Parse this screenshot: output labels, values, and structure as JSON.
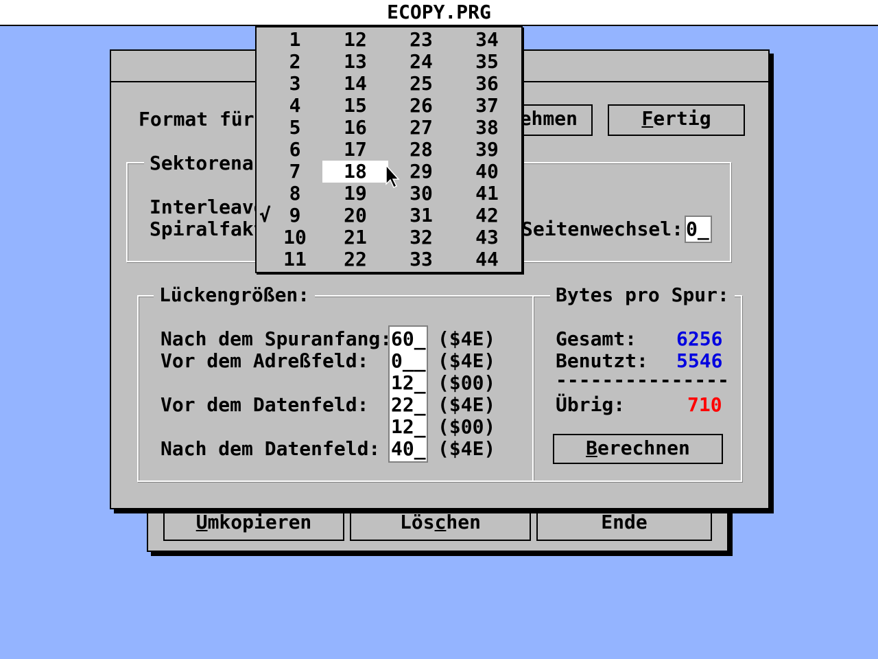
{
  "app": {
    "title": "ECOPY.PRG"
  },
  "back_window": {
    "buttons": [
      {
        "pre": "",
        "u": "U",
        "post": "mkopieren"
      },
      {
        "pre": "Lös",
        "u": "c",
        "post": "hen"
      },
      {
        "pre": "",
        "u": "",
        "post": "Ende"
      }
    ]
  },
  "dialog": {
    "format_label": "Format für",
    "button_nehmen": "ehmen",
    "button_fertig": {
      "u": "F",
      "post": "ertig"
    },
    "sector_group_label": "Sektorenan",
    "interleave_label": "Interleave",
    "spiral_label": "Spiralfakt",
    "side_change_label": "Seitenwechsel:",
    "side_change_value": "0_",
    "gap_group": {
      "label": "Lückengrößen:",
      "rows": [
        {
          "label": "Nach dem Spuranfang:",
          "value": "60_",
          "hex": "($4E)"
        },
        {
          "label": "Vor dem Adreßfeld:",
          "value": "0__",
          "hex": "($4E)"
        },
        {
          "label": "",
          "value": "12_",
          "hex": "($00)"
        },
        {
          "label": "Vor dem Datenfeld:",
          "value": "22_",
          "hex": "($4E)"
        },
        {
          "label": "",
          "value": "12_",
          "hex": "($00)"
        },
        {
          "label": "Nach dem Datenfeld:",
          "value": "40_",
          "hex": "($4E)"
        }
      ]
    },
    "bytes_group": {
      "label": "Bytes pro Spur:",
      "total_label": "Gesamt:",
      "total_value": "6256",
      "used_label": "Benutzt:",
      "used_value": "5546",
      "separator": "---------------",
      "rest_label": "Übrig:",
      "rest_value": "710",
      "calc_button": {
        "u": "B",
        "post": "erechnen"
      }
    }
  },
  "popup": {
    "checkmark": "√",
    "checked_value": "9",
    "highlighted_value": "18",
    "columns": [
      [
        "1",
        "2",
        "3",
        "4",
        "5",
        "6",
        "7",
        "8",
        "9",
        "10",
        "11"
      ],
      [
        "12",
        "13",
        "14",
        "15",
        "16",
        "17",
        "18",
        "19",
        "20",
        "21",
        "22"
      ],
      [
        "23",
        "24",
        "25",
        "26",
        "27",
        "28",
        "29",
        "30",
        "31",
        "32",
        "33"
      ],
      [
        "34",
        "35",
        "36",
        "37",
        "38",
        "39",
        "40",
        "41",
        "42",
        "43",
        "44"
      ]
    ]
  },
  "colors": {
    "desktop": "#94b4ff",
    "window": "#c0c0c0",
    "value_blue": "#0000e0",
    "value_red": "#ff0000"
  }
}
